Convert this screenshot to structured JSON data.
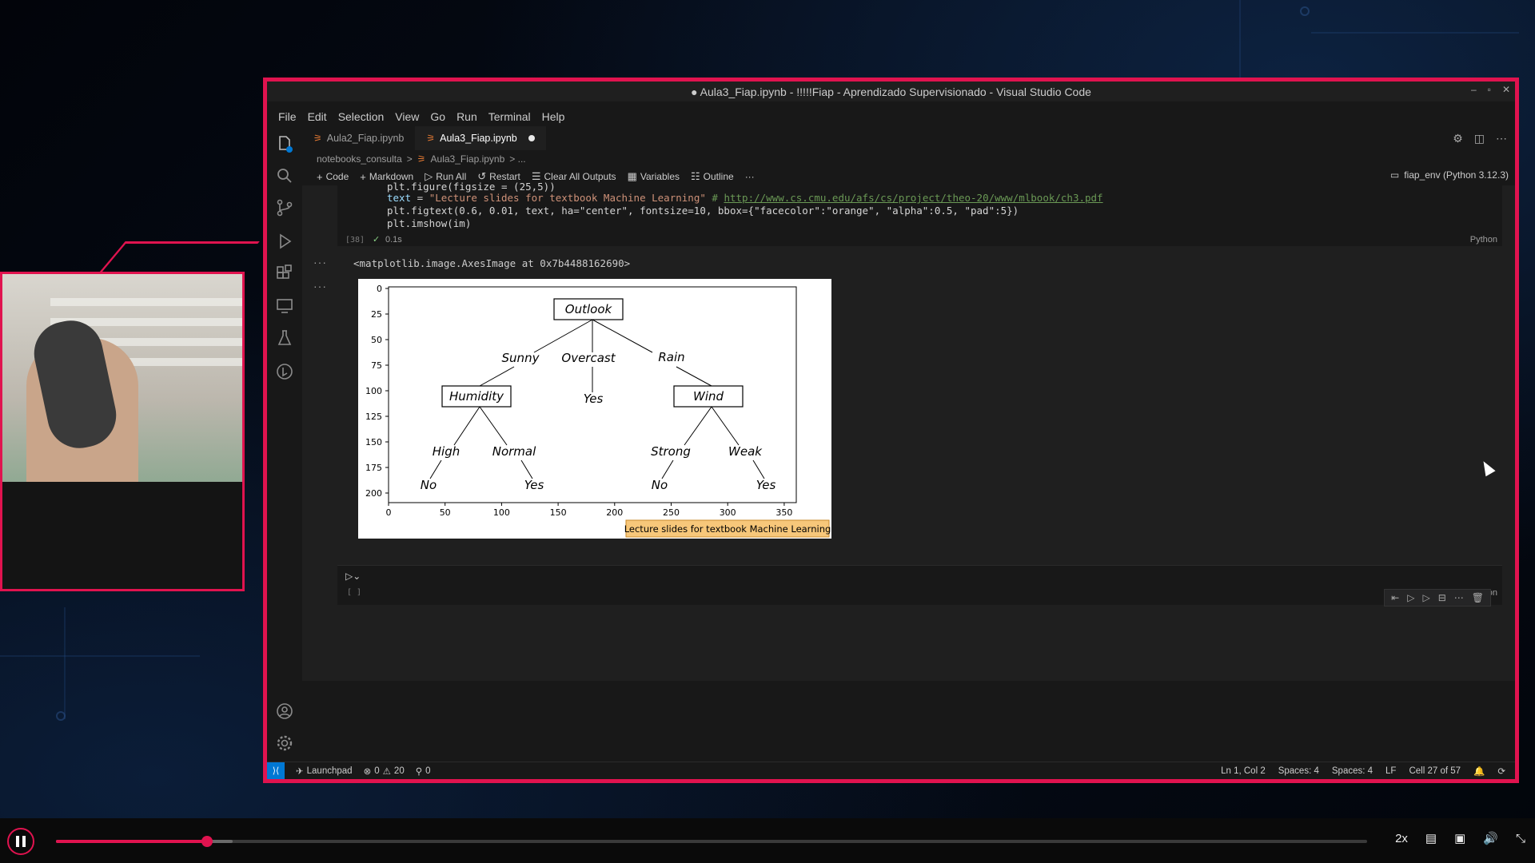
{
  "window": {
    "title": "● Aula3_Fiap.ipynb - !!!!!Fiap - Aprendizado Supervisionado - Visual Studio Code"
  },
  "menu": [
    "File",
    "Edit",
    "Selection",
    "View",
    "Go",
    "Run",
    "Terminal",
    "Help"
  ],
  "tabs": [
    {
      "label": "Aula2_Fiap.ipynb",
      "active": false
    },
    {
      "label": "Aula3_Fiap.ipynb",
      "active": true,
      "dirty": true
    }
  ],
  "breadcrumb": [
    "notebooks_consulta",
    ">",
    "Aula3_Fiap.ipynb",
    "> ..."
  ],
  "notebook_toolbar": {
    "code": "Code",
    "markdown": "Markdown",
    "run_all": "Run All",
    "restart": "Restart",
    "clear_outputs": "Clear All Outputs",
    "variables": "Variables",
    "outline": "Outline",
    "more": "···"
  },
  "kernel": "fiap_env (Python 3.12.3)",
  "code_cell": {
    "line1": "plt.figure(figsize = (25,5))",
    "line2_var": "text",
    "line2_str": "\"Lecture slides for textbook Machine Learning\"",
    "line2_comment": "# ",
    "line2_link": "http://www.cs.cmu.edu/afs/cs/project/theo-20/www/mlbook/ch3.pdf",
    "line3": "plt.figtext(0.6, 0.01, text, ha=\"center\", fontsize=10, bbox={\"facecolor\":\"orange\", \"alpha\":0.5, \"pad\":5})",
    "line4": "plt.imshow(im)",
    "exec_count": "[38]",
    "exec_time": "0.1s",
    "language": "Python"
  },
  "output": {
    "text": "<matplotlib.image.AxesImage at 0x7b4488162690>",
    "dots": "···"
  },
  "plot": {
    "y_ticks": [
      "0",
      "25",
      "50",
      "75",
      "100",
      "125",
      "150",
      "175",
      "200"
    ],
    "x_ticks": [
      "0",
      "50",
      "100",
      "150",
      "200",
      "250",
      "300",
      "350"
    ],
    "caption": "Lecture slides for textbook Machine Learning",
    "caption_color": "#f7c77a",
    "tree": {
      "root": "Outlook",
      "branches": [
        "Sunny",
        "Overcast",
        "Rain"
      ],
      "left_node": "Humidity",
      "middle_leaf": "Yes",
      "right_node": "Wind",
      "left_branches": [
        "High",
        "Normal"
      ],
      "left_leaves": [
        "No",
        "Yes"
      ],
      "right_branches": [
        "Strong",
        "Weak"
      ],
      "right_leaves": [
        "No",
        "Yes"
      ]
    }
  },
  "empty_cell": {
    "exec_count": "[ ]",
    "language": "Python"
  },
  "statusbar": {
    "launchpad": "Launchpad",
    "errors": "0",
    "warnings": "20",
    "ports": "0",
    "position": "Ln 1, Col 2",
    "spaces1": "Spaces: 4",
    "spaces2": "Spaces: 4",
    "eol": "LF",
    "cell": "Cell 27 of 57"
  },
  "player": {
    "speed": "2x",
    "progress": 0.115,
    "buffered": 0.135
  },
  "colors": {
    "frame_accent": "#e0134f",
    "vscode_blue": "#0078d4"
  }
}
